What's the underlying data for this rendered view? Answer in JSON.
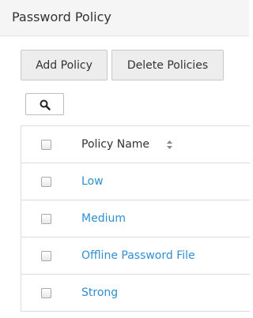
{
  "header": {
    "title": "Password Policy"
  },
  "toolbar": {
    "add_label": "Add Policy",
    "delete_label": "Delete Policies"
  },
  "search": {
    "icon": "search-icon"
  },
  "table": {
    "column_header": "Policy Name",
    "sort_icon": "sort-icon",
    "rows": [
      {
        "name": "Low"
      },
      {
        "name": "Medium"
      },
      {
        "name": "Offline Password File"
      },
      {
        "name": "Strong"
      }
    ]
  },
  "colors": {
    "link": "#2f8fd1",
    "header_bg": "#f5f5f5",
    "button_bg": "#ededed"
  }
}
